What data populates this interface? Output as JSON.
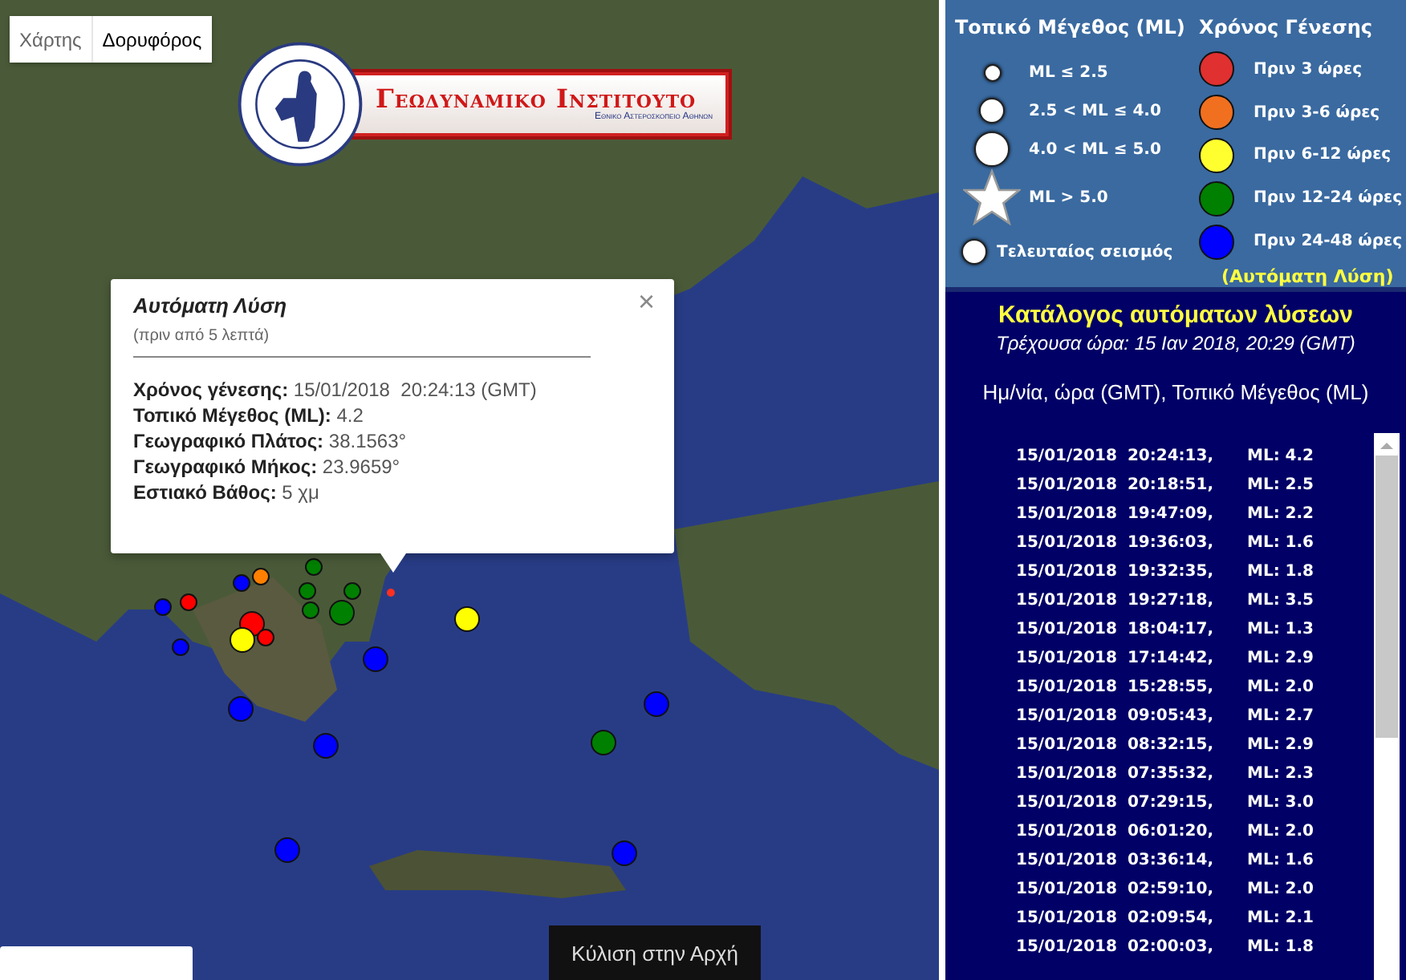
{
  "map": {
    "map_types": [
      {
        "label": "Χάρτης",
        "selected": false
      },
      {
        "label": "Δορυφόρος",
        "selected": true
      }
    ],
    "logo": {
      "title": "Γεωδυναμικο Ινστιτουτο",
      "subtitle": "Εθνικο Αστεροσκοπειο Αθηνων"
    },
    "markers": [
      {
        "kind": "small",
        "color": "#008000"
      },
      {
        "kind": "small",
        "color": "#ff8000"
      },
      {
        "kind": "small",
        "color": "#0000ff"
      },
      {
        "kind": "small",
        "color": "#008000"
      },
      {
        "kind": "small",
        "color": "#008000"
      },
      {
        "kind": "small",
        "color": "#0000ff"
      },
      {
        "kind": "small",
        "color": "#ff0000"
      },
      {
        "kind": "small",
        "color": "#008000"
      },
      {
        "kind": "medium",
        "color": "#008000"
      },
      {
        "kind": "medium",
        "color": "#ff0000"
      },
      {
        "kind": "small",
        "color": "#ff0000"
      },
      {
        "kind": "medium",
        "color": "#ffff00"
      },
      {
        "kind": "small",
        "color": "#0000ff"
      },
      {
        "kind": "medium",
        "color": "#ffff00"
      },
      {
        "kind": "medium",
        "color": "#0000ff"
      },
      {
        "kind": "medium",
        "color": "#0000ff"
      },
      {
        "kind": "medium",
        "color": "#0000ff"
      },
      {
        "kind": "medium",
        "color": "#0000ff"
      },
      {
        "kind": "medium",
        "color": "#008000"
      },
      {
        "kind": "medium",
        "color": "#0000ff"
      },
      {
        "kind": "medium",
        "color": "#0000ff"
      },
      {
        "kind": "latest",
        "color": "#ff3020"
      }
    ],
    "popup": {
      "title": "Αυτόματη Λύση",
      "subtitle": "(πριν από 5 λεπτά)",
      "close": "×",
      "lines": [
        "**Χρόνος γένεσης:** 15/01/2018  20:24:13 (GMT)",
        "**Τοπικό Μέγεθος (ML):** 4.2",
        "**Γεωγραφικό Πλάτος:** 38.1563°",
        "**Γεωγραφικό Μήκος:** 23.9659°",
        "**Εστιακό Βάθος:** 5 χμ"
      ]
    },
    "scroll_top_button": "Κύλιση στην Αρχή"
  },
  "legend": {
    "magnitude_title": "Τοπικό Μέγεθος (ML)",
    "magnitudes": [
      {
        "kind": "small",
        "label": "ML ≤ 2.5"
      },
      {
        "kind": "medium",
        "label": "2.5 < ML ≤ 4.0"
      },
      {
        "kind": "large",
        "label": "4.0 < ML ≤ 5.0"
      },
      {
        "kind": "star",
        "label": "ML > 5.0"
      },
      {
        "kind": "latest",
        "label": "Τελευταίος σεισμός"
      }
    ],
    "time_title": "Χρόνος Γένεσης",
    "times": [
      {
        "label": "Πριν 3 ώρες",
        "color": "#e03030"
      },
      {
        "label": "Πριν 3-6 ώρες",
        "color": "#f07020"
      },
      {
        "label": "Πριν 6-12 ώρες",
        "color": "#ffff30"
      },
      {
        "label": "Πριν 12-24 ώρες",
        "color": "#008000"
      },
      {
        "label": "Πριν 24-48 ώρες",
        "color": "#0000ff"
      }
    ],
    "note": "(Αυτόματη Λύση)"
  },
  "catalog": {
    "title": "Κατάλογος αυτόματων λύσεων",
    "current_time": "Τρέχουσα ώρα: 15 Ιαν 2018, 20:29 (GMT)",
    "header": "Ημ/νία, ώρα (GMT), Τοπικό Μέγεθος (ML)",
    "rows": [
      {
        "time": "15/01/2018 20:24:13,",
        "ml": "ML: 4.2"
      },
      {
        "time": "15/01/2018 20:18:51,",
        "ml": "ML: 2.5"
      },
      {
        "time": "15/01/2018 19:47:09,",
        "ml": "ML: 2.2"
      },
      {
        "time": "15/01/2018 19:36:03,",
        "ml": "ML: 1.6"
      },
      {
        "time": "15/01/2018 19:32:35,",
        "ml": "ML: 1.8"
      },
      {
        "time": "15/01/2018 19:27:18,",
        "ml": "ML: 3.5"
      },
      {
        "time": "15/01/2018 18:04:17,",
        "ml": "ML: 1.3"
      },
      {
        "time": "15/01/2018 17:14:42,",
        "ml": "ML: 2.9"
      },
      {
        "time": "15/01/2018 15:28:55,",
        "ml": "ML: 2.0"
      },
      {
        "time": "15/01/2018 09:05:43,",
        "ml": "ML: 2.7"
      },
      {
        "time": "15/01/2018 08:32:15,",
        "ml": "ML: 2.9"
      },
      {
        "time": "15/01/2018 07:35:32,",
        "ml": "ML: 2.3"
      },
      {
        "time": "15/01/2018 07:29:15,",
        "ml": "ML: 3.0"
      },
      {
        "time": "15/01/2018 06:01:20,",
        "ml": "ML: 2.0"
      },
      {
        "time": "15/01/2018 03:36:14,",
        "ml": "ML: 1.6"
      },
      {
        "time": "15/01/2018 02:59:10,",
        "ml": "ML: 2.0"
      },
      {
        "time": "15/01/2018 02:09:54,",
        "ml": "ML: 2.1"
      },
      {
        "time": "15/01/2018 02:00:03,",
        "ml": "ML: 1.8"
      }
    ]
  }
}
